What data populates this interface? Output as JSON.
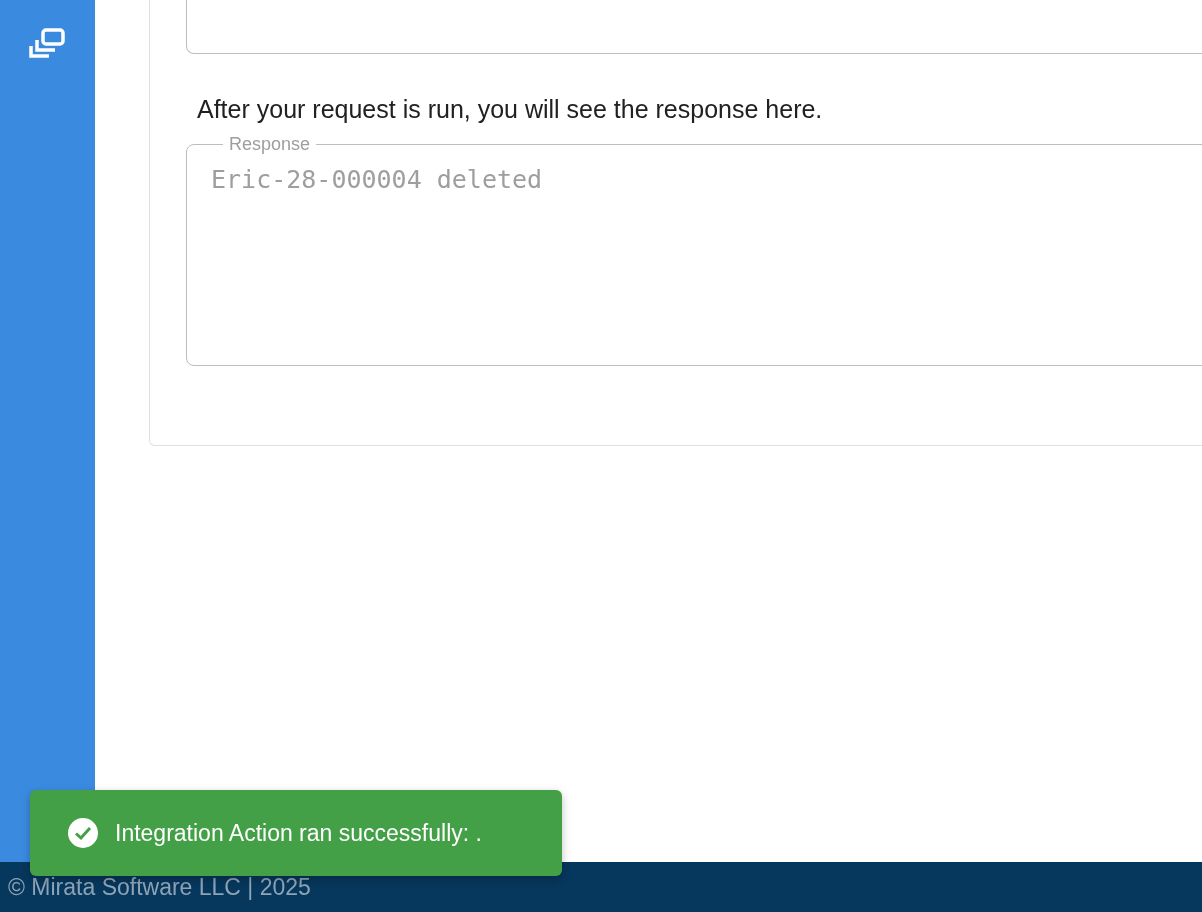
{
  "instructions": "After your request is run, you will see the response here.",
  "response": {
    "label": "Response",
    "value": "Eric-28-000004 deleted",
    "disabled": true
  },
  "toast": {
    "kind": "success",
    "message": "Integration Action ran successfully: ."
  },
  "footer": {
    "text": "© Mirata Software LLC | 2025"
  }
}
